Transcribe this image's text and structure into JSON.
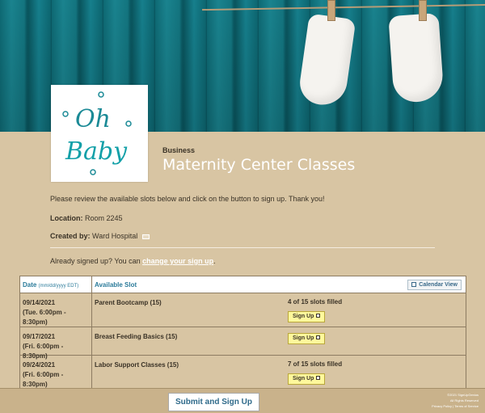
{
  "header": {
    "category": "Business",
    "title": "Maternity Center Classes",
    "logo_text_1": "Oh",
    "logo_text_2": "Baby"
  },
  "intro": "Please review the available slots below and click on the button to sign up. Thank you!",
  "location": {
    "label": "Location:",
    "value": "Room 2245"
  },
  "created_by": {
    "label": "Created by:",
    "value": "Ward Hospital"
  },
  "already_signed": {
    "prefix": "Already signed up? You can ",
    "link": "change your sign up",
    "suffix": "."
  },
  "table": {
    "date_header": "Date",
    "date_format": "(mm/dd/yyyy EDT)",
    "slot_header": "Available Slot",
    "calendar_view": "Calendar View",
    "rows": [
      {
        "date": "09/14/2021",
        "time": "(Tue. 6:00pm - 8:30pm)",
        "slot": "Parent Bootcamp (15)",
        "status": "4 of 15 slots filled",
        "button": "Sign Up"
      },
      {
        "date": "09/17/2021",
        "time": "(Fri. 6:00pm - 8:30pm)",
        "slot": "Breast Feeding Basics (15)",
        "status": "",
        "button": "Sign Up"
      },
      {
        "date": "09/24/2021",
        "time": "(Fri. 6:00pm - 8:30pm)",
        "slot": "Labor Support Classes (15)",
        "status": "7 of 15 slots filled",
        "button": "Sign Up"
      }
    ]
  },
  "footer": {
    "submit": "Submit and Sign Up",
    "copyright": "©2021 SignUpGenius",
    "rights": "All Rights Reserved",
    "privacy": "Privacy Policy | Terms of Service"
  }
}
